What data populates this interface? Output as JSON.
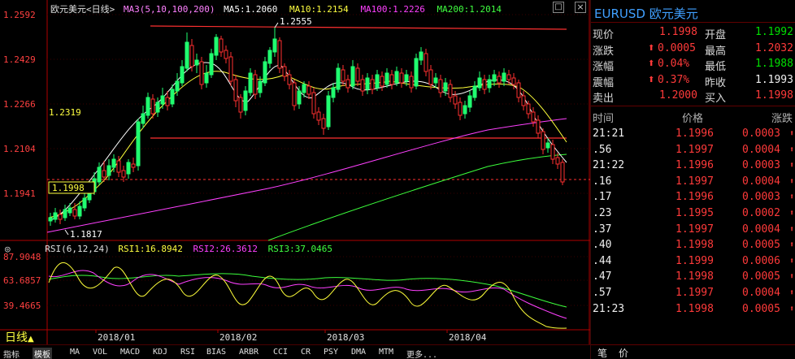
{
  "chart_header": {
    "symbol_title": "欧元美元<日线>",
    "ma_label": "MA3(5,10,100,200)",
    "ma5": "MA5:1.2060",
    "ma10": "MA10:1.2154",
    "ma100": "MA100:1.2226",
    "ma200": "MA200:1.2014"
  },
  "price_axis": [
    "1.2592",
    "1.2429",
    "1.2266",
    "1.2104",
    "1.1941"
  ],
  "annotations": {
    "high": "1.2555",
    "low": "1.1817",
    "mid": "1.2319",
    "last": "1.1998"
  },
  "rsi_header": {
    "label": "RSI(6,12,24)",
    "rsi1": "RSI1:16.8942",
    "rsi2": "RSI2:26.3612",
    "rsi3": "RSI3:37.0465"
  },
  "rsi_axis": [
    "87.9048",
    "63.6857",
    "39.4665"
  ],
  "dates": [
    "2018/01",
    "2018/02",
    "2018/03",
    "2018/04"
  ],
  "period_label": "日线",
  "toolbar": [
    "指标",
    "模板",
    "MA",
    "VOL",
    "MACD",
    "KDJ",
    "RSI",
    "BIAS",
    "ARBR",
    "CCI",
    "CR",
    "PSY",
    "DMA",
    "MTM",
    "更多..."
  ],
  "panel": {
    "title": "EURUSD 欧元美元",
    "quotes": [
      {
        "l1": "现价",
        "v1": "1.1998",
        "l2": "开盘",
        "v2": "1.1992"
      },
      {
        "l1": "涨跌",
        "v1": "0.0005",
        "l2": "最高",
        "v2": "1.2032"
      },
      {
        "l1": "涨幅",
        "v1": "0.04%",
        "l2": "最低",
        "v2": "1.1988"
      },
      {
        "l1": "震幅",
        "v1": "0.37%",
        "l2": "昨收",
        "v2": "1.1993"
      },
      {
        "l1": "卖出",
        "v1": "1.2000",
        "l2": "买入",
        "v2": "1.1998"
      }
    ],
    "tick_header": {
      "time": "时间",
      "price": "价格",
      "change": "涨跌"
    },
    "ticks": [
      {
        "time": "21:21",
        "price": "1.1996",
        "chg": "0.0003"
      },
      {
        "time": ".56",
        "price": "1.1997",
        "chg": "0.0004"
      },
      {
        "time": "21:22",
        "price": "1.1996",
        "chg": "0.0003"
      },
      {
        "time": ".16",
        "price": "1.1997",
        "chg": "0.0004"
      },
      {
        "time": ".17",
        "price": "1.1996",
        "chg": "0.0003"
      },
      {
        "time": ".23",
        "price": "1.1995",
        "chg": "0.0002"
      },
      {
        "time": ".37",
        "price": "1.1997",
        "chg": "0.0004"
      },
      {
        "time": ".40",
        "price": "1.1998",
        "chg": "0.0005"
      },
      {
        "time": ".44",
        "price": "1.1999",
        "chg": "0.0006"
      },
      {
        "time": ".47",
        "price": "1.1998",
        "chg": "0.0005"
      },
      {
        "time": ".57",
        "price": "1.1997",
        "chg": "0.0004"
      },
      {
        "time": "21:23",
        "price": "1.1998",
        "chg": "0.0005"
      }
    ],
    "footer": {
      "a": "笔",
      "b": "价"
    }
  },
  "window_controls": {
    "restore": "□",
    "close": "×"
  },
  "colors": {
    "up": "#00e676",
    "down": "#ff3030",
    "ma5": "#ffffff",
    "ma10": "#ffff40",
    "ma100": "#ff40ff",
    "ma200": "#40ff40",
    "frame": "#b00000"
  }
}
